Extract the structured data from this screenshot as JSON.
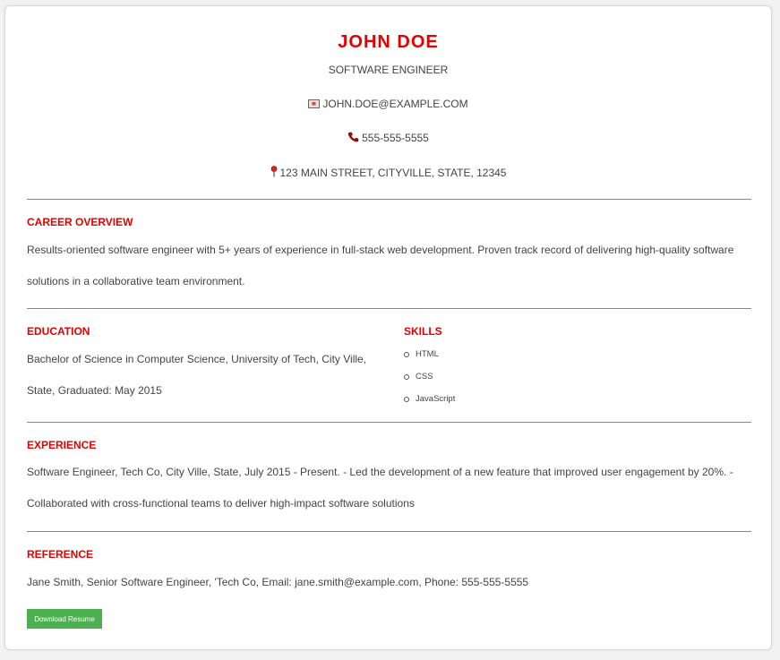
{
  "header": {
    "name": "JOHN DOE",
    "title": "SOFTWARE ENGINEER",
    "email": "JOHN.DOE@EXAMPLE.COM",
    "phone": "555-555-5555",
    "address": "123 MAIN STREET, CITYVILLE, STATE, 12345"
  },
  "icons": {
    "email": "envelope-icon",
    "phone": "telephone-icon",
    "address": "map-pin-icon"
  },
  "career": {
    "title": "CAREER OVERVIEW",
    "text": "Results-oriented software engineer with 5+ years of experience in full-stack web development. Proven track record of delivering high-quality software solutions in a collaborative team environment."
  },
  "education": {
    "title": "EDUCATION",
    "text": "Bachelor of Science in Computer Science, University of Tech, City Ville, State, Graduated: May 2015"
  },
  "skills": {
    "title": "SKILLS",
    "items": [
      "HTML",
      "CSS",
      "JavaScript"
    ]
  },
  "experience": {
    "title": "EXPERIENCE",
    "text": "Software Engineer, Tech Co, City Ville, State, July 2015 - Present. - Led the development of a new feature that improved user engagement by 20%. - Collaborated with cross-functional teams to deliver high-impact software solutions"
  },
  "reference": {
    "title": "REFERENCE",
    "text": "Jane Smith, Senior Software Engineer, 'Tech Co, Email: jane.smith@example.com, Phone: 555-555-5555"
  },
  "actions": {
    "download_label": "Download Resume"
  },
  "colors": {
    "accent": "#e50000",
    "button": "#4caf50"
  }
}
